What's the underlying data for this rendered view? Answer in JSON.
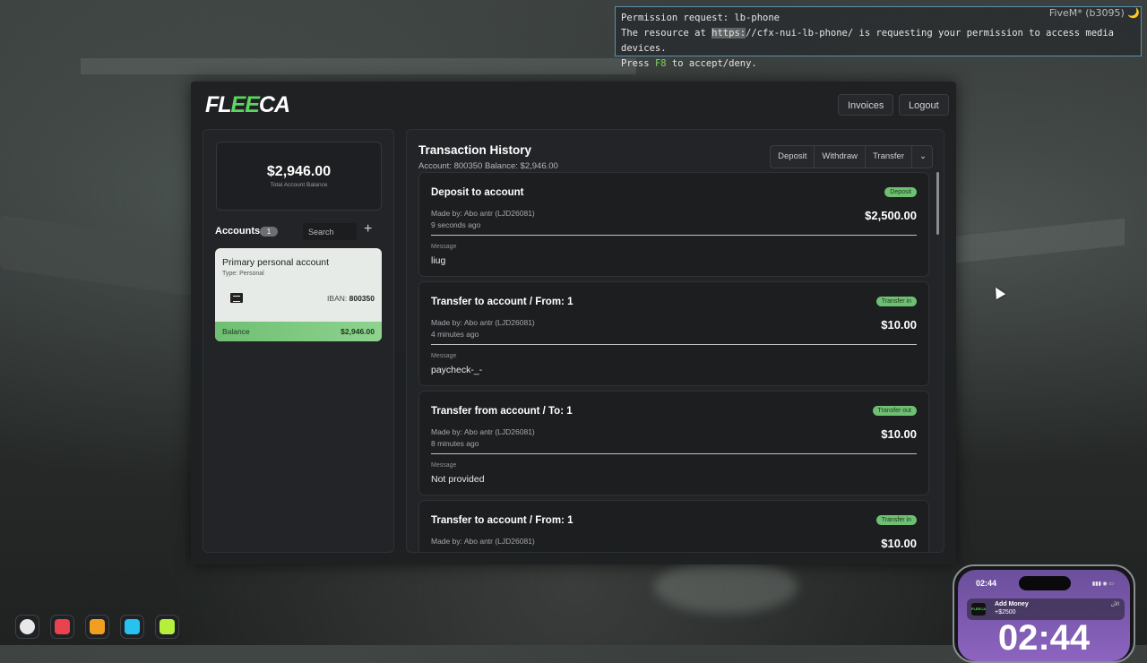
{
  "permission": {
    "title": "Permission request: lb-phone",
    "line2_pre": "The resource at ",
    "url": "https:",
    "line2_post": "//cfx-nui-lb-phone/ is requesting your permission to access media devices.",
    "line3_pre": "Press ",
    "key": "F8",
    "line3_post": " to accept/deny."
  },
  "fivem_tag": "FiveM* (b3095) 🌙",
  "bank": {
    "logo_a": "FL",
    "logo_b": "EE",
    "logo_c": "CA",
    "buttons": {
      "invoices": "Invoices",
      "logout": "Logout"
    },
    "total_balance": "$2,946.00",
    "total_balance_label": "Total Account Balance",
    "accounts_title": "Accounts",
    "accounts_count": "1",
    "search_placeholder": "Search",
    "add_symbol": "+",
    "account": {
      "name": "Primary personal account",
      "type": "Type: Personal",
      "iban_label": "IBAN:",
      "iban": "800350",
      "balance_label": "Balance",
      "balance": "$2,946.00"
    },
    "history": {
      "title": "Transaction History",
      "subtitle": "Account: 800350  Balance: $2,946.00",
      "actions": {
        "deposit": "Deposit",
        "withdraw": "Withdraw",
        "transfer": "Transfer",
        "more": "⌄"
      },
      "transactions": [
        {
          "title": "Deposit to account",
          "made_by": "Made by: Abo antr (LJD26081)",
          "ago": "9 seconds ago",
          "badge": "Deposit",
          "amount": "$2,500.00",
          "message_label": "Message",
          "message": "liug"
        },
        {
          "title": "Transfer to account / From: 1",
          "made_by": "Made by: Abo antr (LJD26081)",
          "ago": "4 minutes ago",
          "badge": "Transfer in",
          "amount": "$10.00",
          "message_label": "Message",
          "message": "paycheck-_-"
        },
        {
          "title": "Transfer from account / To: 1",
          "made_by": "Made by: Abo antr (LJD26081)",
          "ago": "8 minutes ago",
          "badge": "Transfer out",
          "amount": "$10.00",
          "message_label": "Message",
          "message": "Not provided"
        },
        {
          "title": "Transfer to account / From: 1",
          "made_by": "Made by: Abo antr (LJD26081)",
          "ago": "",
          "badge": "Transfer in",
          "amount": "$10.00",
          "message_label": "",
          "message": ""
        }
      ]
    }
  },
  "hud_icons": [
    {
      "name": "user-hud-icon",
      "color": "#e8e8e8"
    },
    {
      "name": "health-hud-icon",
      "color": "#e8434e"
    },
    {
      "name": "food-hud-icon",
      "color": "#f0a020"
    },
    {
      "name": "water-hud-icon",
      "color": "#27c3f0"
    },
    {
      "name": "stamina-hud-icon",
      "color": "#b6f03c"
    }
  ],
  "phone": {
    "status_time": "02:44",
    "notif_app": "FLEECA",
    "notif_title": "Add Money",
    "notif_sub": "+$2500",
    "notif_time": "الآن",
    "big_time": "02:44"
  }
}
